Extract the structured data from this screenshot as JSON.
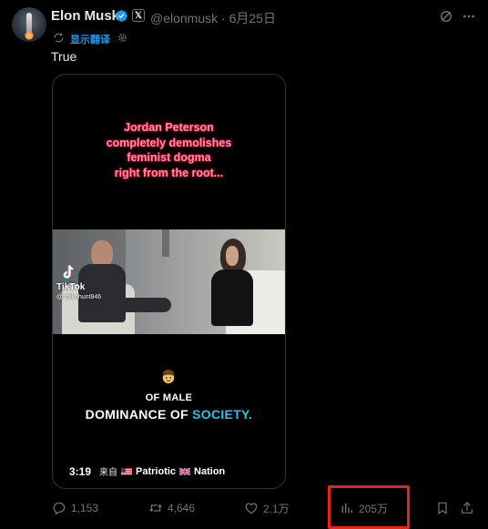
{
  "author": {
    "name": "Elon Musk",
    "handle": "@elonmusk",
    "date": "6月25日",
    "x_badge": "𝕏"
  },
  "translate": {
    "label": "显示翻译"
  },
  "tweet": {
    "text": "True"
  },
  "media": {
    "caption_top_lines": [
      "Jordan Peterson",
      "completely demolishes",
      "feminist dogma",
      "right from the root..."
    ],
    "watermark_brand": "TikTok",
    "watermark_handle": "@ mikehunt846",
    "caption_male": "OF MALE",
    "caption_bottom_prefix": "DOMINANCE OF ",
    "caption_bottom_accent": "SOCIETY.",
    "duration": "3:19",
    "from_label": "来自",
    "source_part1": "Patriotic",
    "source_part2": "Nation"
  },
  "actions": {
    "replies": "1,153",
    "reposts": "4,646",
    "likes": "2.1万",
    "views": "205万"
  },
  "colors": {
    "accent": "#1d9bf0",
    "muted": "#71767b",
    "highlight_border": "#e8211b",
    "caption_pink": "#ff8da0",
    "caption_cyan": "#29c5e8"
  },
  "icons": {
    "verified": "verified-badge-icon",
    "grok": "grok-icon",
    "more": "more-icon",
    "translate": "translate-icon",
    "reply": "reply-icon",
    "retweet": "retweet-icon",
    "like": "heart-icon",
    "views": "views-chart-icon",
    "bookmark": "bookmark-icon",
    "share": "share-icon"
  }
}
